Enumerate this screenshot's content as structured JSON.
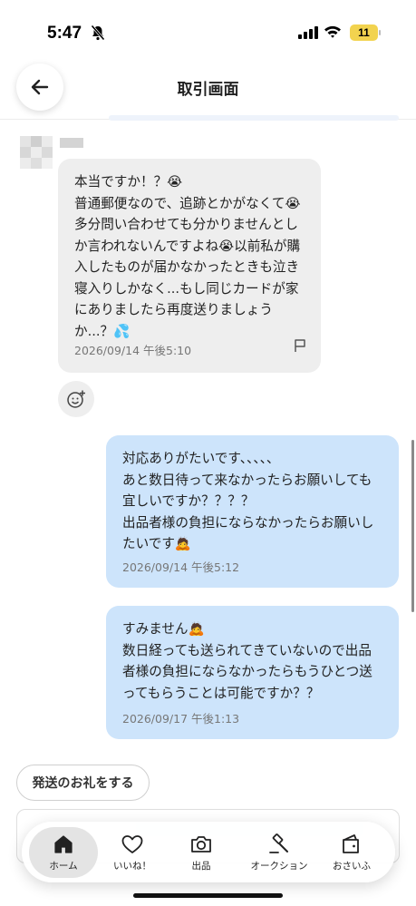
{
  "status_bar": {
    "time": "5:47",
    "battery": "11"
  },
  "header": {
    "title": "取引画面"
  },
  "messages": [
    {
      "direction": "incoming",
      "text": "本当ですか！？😭\n普通郵便なので、追跡とかがなくて😭多分問い合わせても分かりませんとしか言われないんですよね😭以前私が購入したものが届かなかったときも泣き寝入りしかなく...もし同じカードが家にありましたら再度送りましょうか...？💦",
      "date": "2026/09/14 午後5:10"
    },
    {
      "direction": "outgoing",
      "text": "対応ありがたいです、、、、、\nあと数日待って来なかったらお願いしても宜しいですか？？？？\n出品者様の負担にならなかったらお願いしたいです🙇",
      "date": "2026/09/14 午後5:12"
    },
    {
      "direction": "outgoing",
      "text": "すみません🙇\n数日経っても送られてきていないので出品者様の負担にならなかったらもうひとつ送ってもらうことは可能ですか？？",
      "date": "2026/09/17 午後1:13"
    }
  ],
  "actions": {
    "thanks_label": "発送のお礼をする"
  },
  "nav": [
    {
      "label": "ホーム",
      "icon": "home-icon",
      "active": true
    },
    {
      "label": "いいね！",
      "icon": "heart-icon",
      "active": false
    },
    {
      "label": "出品",
      "icon": "camera-icon",
      "active": false
    },
    {
      "label": "オークション",
      "icon": "gavel-icon",
      "active": false
    },
    {
      "label": "おさいふ",
      "icon": "wallet-icon",
      "active": false
    }
  ],
  "colors": {
    "incoming_bubble": "#eeeeee",
    "outgoing_bubble": "#cde4fb",
    "battery": "#f2d34f"
  }
}
